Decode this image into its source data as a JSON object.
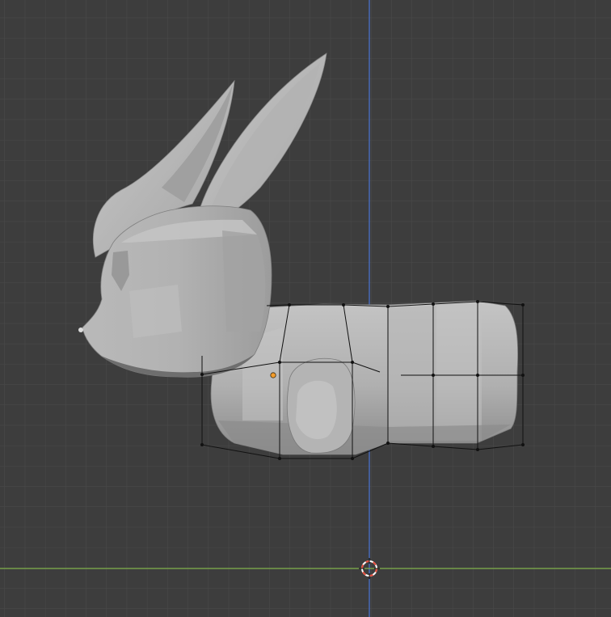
{
  "viewport": {
    "editor": "3d-viewport",
    "view": "front-orthographic",
    "mode": "edit-mode",
    "object": "rabbit-mesh",
    "grid": true,
    "colors": {
      "background": "#3d3d3d",
      "grid_minor": "#4b4b4b",
      "grid_major": "#525252",
      "x_axis": "#7fb04a",
      "z_axis": "#4a74d6",
      "mesh_light": "#bcbcbc",
      "mesh_mid": "#a6a6a6",
      "mesh_dark": "#8e8e8e",
      "mesh_shadow": "#6f6f6f",
      "cage_edge": "#111111",
      "origin_dot": "#f39c2b",
      "cursor_red": "#e74c3c"
    },
    "icons": {
      "cursor": "3d-cursor-icon",
      "origin": "object-origin-icon"
    }
  }
}
